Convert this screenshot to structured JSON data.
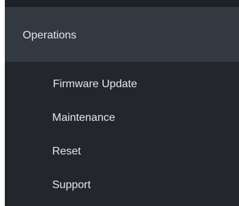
{
  "sidebar": {
    "section": {
      "label": "Operations"
    },
    "items": [
      {
        "label": "Firmware Update"
      },
      {
        "label": "Maintenance"
      },
      {
        "label": "Reset"
      },
      {
        "label": "Support"
      }
    ]
  },
  "colors": {
    "sidebar_bg": "#23262b",
    "section_header_bg": "#323941",
    "text": "#e6e8ea"
  }
}
